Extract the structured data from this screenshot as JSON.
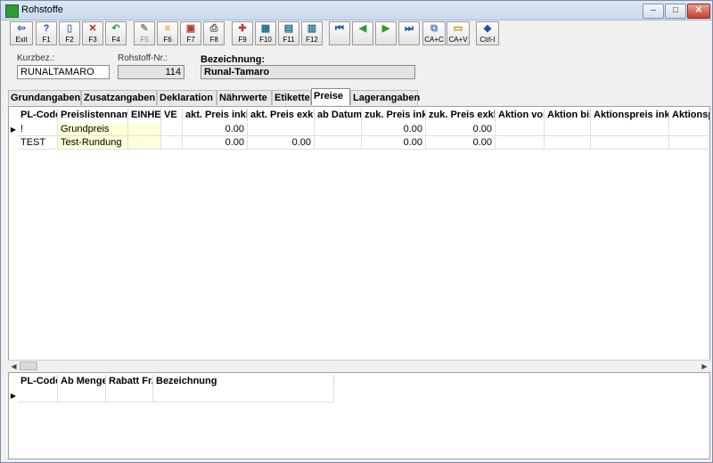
{
  "window": {
    "title": "Rohstoffe",
    "icon": "app-icon",
    "controls": [
      {
        "name": "minimize-button",
        "glyph": "–"
      },
      {
        "name": "maximize-button",
        "glyph": "□"
      },
      {
        "name": "close-button",
        "glyph": "✕"
      }
    ]
  },
  "toolbar": {
    "buttons": [
      {
        "name": "exit-button",
        "label": "Exit",
        "glyph": "⇦",
        "color": "#1f4fa8",
        "disabled": false
      },
      {
        "name": "f1-button",
        "label": "F1",
        "glyph": "?",
        "color": "#1f4fa8",
        "disabled": false
      },
      {
        "name": "f2-button",
        "label": "F2",
        "glyph": "▯",
        "color": "#5a7fbf",
        "disabled": false
      },
      {
        "name": "f3-button",
        "label": "F3",
        "glyph": "✕",
        "color": "#d21b1b",
        "disabled": false
      },
      {
        "name": "f4-button",
        "label": "F4",
        "glyph": "↶",
        "color": "#2e9a2e",
        "disabled": false
      },
      {
        "name": "f5-button",
        "label": "F5",
        "glyph": "✎",
        "color": "#8a8a8a",
        "disabled": true
      },
      {
        "name": "f6-button",
        "label": "F6",
        "glyph": "≡",
        "color": "#c48a00",
        "disabled": false
      },
      {
        "name": "f7-button",
        "label": "F7",
        "glyph": "▣",
        "color": "#b03a2e",
        "disabled": false
      },
      {
        "name": "f8-button",
        "label": "F8",
        "glyph": "⎙",
        "color": "#555555",
        "disabled": false
      },
      {
        "name": "f9-button",
        "label": "F9",
        "glyph": "✚",
        "color": "#c0392b",
        "disabled": false
      },
      {
        "name": "f10-button",
        "label": "F10",
        "glyph": "▦",
        "color": "#1a6e8a",
        "disabled": false
      },
      {
        "name": "f11-button",
        "label": "F11",
        "glyph": "▤",
        "color": "#1a6e8a",
        "disabled": false
      },
      {
        "name": "f12-button",
        "label": "F12",
        "glyph": "▥",
        "color": "#1a6e8a",
        "disabled": false
      },
      {
        "name": "first-record-button",
        "label": "",
        "glyph": "⏮",
        "color": "#1f4fa8",
        "disabled": false
      },
      {
        "name": "previous-record-button",
        "label": "",
        "glyph": "◀",
        "color": "#2e9a2e",
        "disabled": false
      },
      {
        "name": "next-record-button",
        "label": "",
        "glyph": "▶",
        "color": "#2e9a2e",
        "disabled": false
      },
      {
        "name": "last-record-button",
        "label": "",
        "glyph": "⏭",
        "color": "#1f4fa8",
        "disabled": false
      },
      {
        "name": "copy-button",
        "label": "CA+C",
        "glyph": "⧉",
        "color": "#5a7fbf",
        "disabled": false
      },
      {
        "name": "paste-button",
        "label": "CA+V",
        "glyph": "▭",
        "color": "#c48a00",
        "disabled": false
      },
      {
        "name": "ctrl-i-button",
        "label": "Ctrl-I",
        "glyph": "◆",
        "color": "#1f4fa8",
        "disabled": false
      }
    ]
  },
  "header": {
    "kurzbez_label": "Kurzbez.:",
    "kurzbez_value": "RUNALTAMARO",
    "nr_label": "Rohstoff-Nr.:",
    "nr_value": "114",
    "bez_label": "Bezeichnung:",
    "bez_value": "Runal-Tamaro"
  },
  "tabs": [
    {
      "name": "tab-grundangaben",
      "label": "Grundangaben",
      "active": false
    },
    {
      "name": "tab-zusatzangaben",
      "label": "Zusatzangaben",
      "active": false
    },
    {
      "name": "tab-deklaration",
      "label": "Deklaration",
      "active": false
    },
    {
      "name": "tab-naehrwerte",
      "label": "Nährwerte",
      "active": false
    },
    {
      "name": "tab-etikette",
      "label": "Etikette",
      "active": false
    },
    {
      "name": "tab-preise",
      "label": "Preise",
      "active": true
    },
    {
      "name": "tab-lagerangaben",
      "label": "Lagerangaben",
      "active": false
    }
  ],
  "price_grid": {
    "columns": [
      "PL-Code",
      "Preislistenname",
      "EINHEIT",
      "VE",
      "akt. Preis inkl.",
      "akt. Preis exkl.",
      "ab Datum",
      "zuk. Preis inkl.",
      "zuk. Preis exkl.",
      "Aktion von",
      "Aktion bis",
      "Aktionspreis inkl.",
      "Aktionspreis exkl."
    ],
    "rows": [
      {
        "current": true,
        "cells": [
          "!",
          "Grundpreis",
          "",
          "",
          "0.00",
          "",
          "",
          "0.00",
          "0.00",
          "",
          "",
          "",
          ""
        ]
      },
      {
        "current": false,
        "cells": [
          "TEST",
          "Test-Rundung",
          "",
          "",
          "0.00",
          "0.00",
          "",
          "0.00",
          "0.00",
          "",
          "",
          "",
          ""
        ]
      }
    ]
  },
  "scale_grid": {
    "columns": [
      "PL-Code",
      "Ab Menge",
      "Rabatt Fr.",
      "Bezeichnung"
    ],
    "rows": [
      {
        "current": true,
        "cells": [
          "",
          "",
          "",
          ""
        ]
      }
    ]
  },
  "colors": {
    "yellow_cell": "#ffffd8"
  }
}
